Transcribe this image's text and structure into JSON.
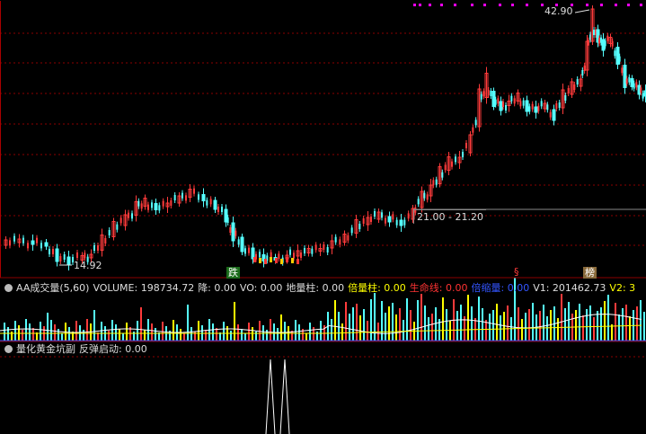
{
  "price_panel": {
    "high_label": "42.90",
    "low_label": "14.92",
    "range_label": "21.00 - 21.20",
    "signal_labels": [
      "跌",
      "§",
      "榜"
    ],
    "colors": {
      "up": "#ff3b3b",
      "down": "#5ff",
      "grid": "#8b0000",
      "accent": "#ff00ff"
    }
  },
  "volume_panel": {
    "indicator_name": "AA成交量(5,60)",
    "fields": [
      {
        "label": "VOLUME: 198734.72",
        "color": "#dddddd"
      },
      {
        "label": "降: 0.00",
        "color": "#dddddd"
      },
      {
        "label": "VO: 0.00",
        "color": "#dddddd"
      },
      {
        "label": "地量柱: 0.00",
        "color": "#dddddd"
      },
      {
        "label": "倍量柱: 0.00",
        "color": "#ffff00"
      },
      {
        "label": "生命线: 0.00",
        "color": "#ff3333"
      },
      {
        "label": "倍缩量: 0.00",
        "color": "#3355ff"
      },
      {
        "label": "V1: 201462.73",
        "color": "#dddddd"
      },
      {
        "label": "V2: 3",
        "color": "#ffff00"
      }
    ]
  },
  "sub_panel": {
    "indicator_name": "量化黄金坑副",
    "field_label": "反弹启动: 0.00"
  }
}
